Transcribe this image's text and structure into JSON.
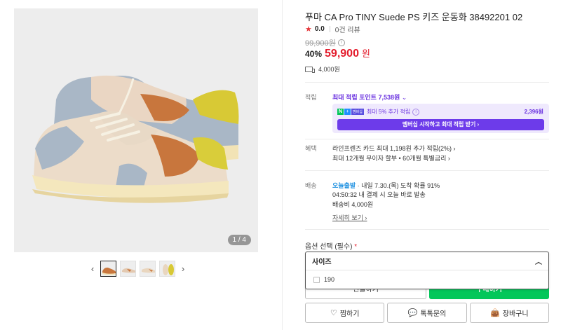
{
  "gallery": {
    "counter_current": "1",
    "counter_total": "4",
    "counter_text": "1 / 4",
    "prev_arrow": "‹",
    "next_arrow": "›",
    "thumbnail_count": 4
  },
  "product": {
    "title": "푸마 CA Pro TINY Suede PS 키즈 운동화 38492201 02",
    "rating": "0.0",
    "review_count": "0건 리뷰",
    "original_price": "99,900원",
    "discount": "40%",
    "sale_price": "59,900",
    "currency": "원",
    "shipping_fee": "4,000원"
  },
  "points": {
    "label": "적립",
    "max_points": "최대 적립 포인트 7,538원",
    "npay_text": "최대 5% 추가 적립",
    "npay_amount": "2,396원",
    "npay_button": "멤버십 시작하고 최대 적립 받기 ›"
  },
  "benefits": {
    "label": "혜택",
    "line1": "라인프렌즈 카드 최대 1,198원 추가 적립(2%) ›",
    "line2": "최대 12개월 무이자 할부 • 60개월 특별금리 ›"
  },
  "delivery": {
    "label": "배송",
    "badge": "오늘출발",
    "line1": " · 내일 7.30.(목) 도착 확률 91%",
    "line2": "04:50:32  내 결제 시 오늘 바로 발송",
    "line3": "배송비 4,000원",
    "detail_link": "자세히 보기 ›"
  },
  "options": {
    "label": "옵션 선택 (필수)",
    "required_mark": "*",
    "select_label": "사이즈",
    "options": [
      "190"
    ]
  },
  "buttons": {
    "gift": "선물하기",
    "buy": "구매하기",
    "wish": "찜하기",
    "talk": "톡톡문의",
    "cart": "장바구니"
  },
  "colors": {
    "accent_purple": "#6d3bea",
    "sale_red": "#e31c2c",
    "buy_green": "#03c75a"
  }
}
